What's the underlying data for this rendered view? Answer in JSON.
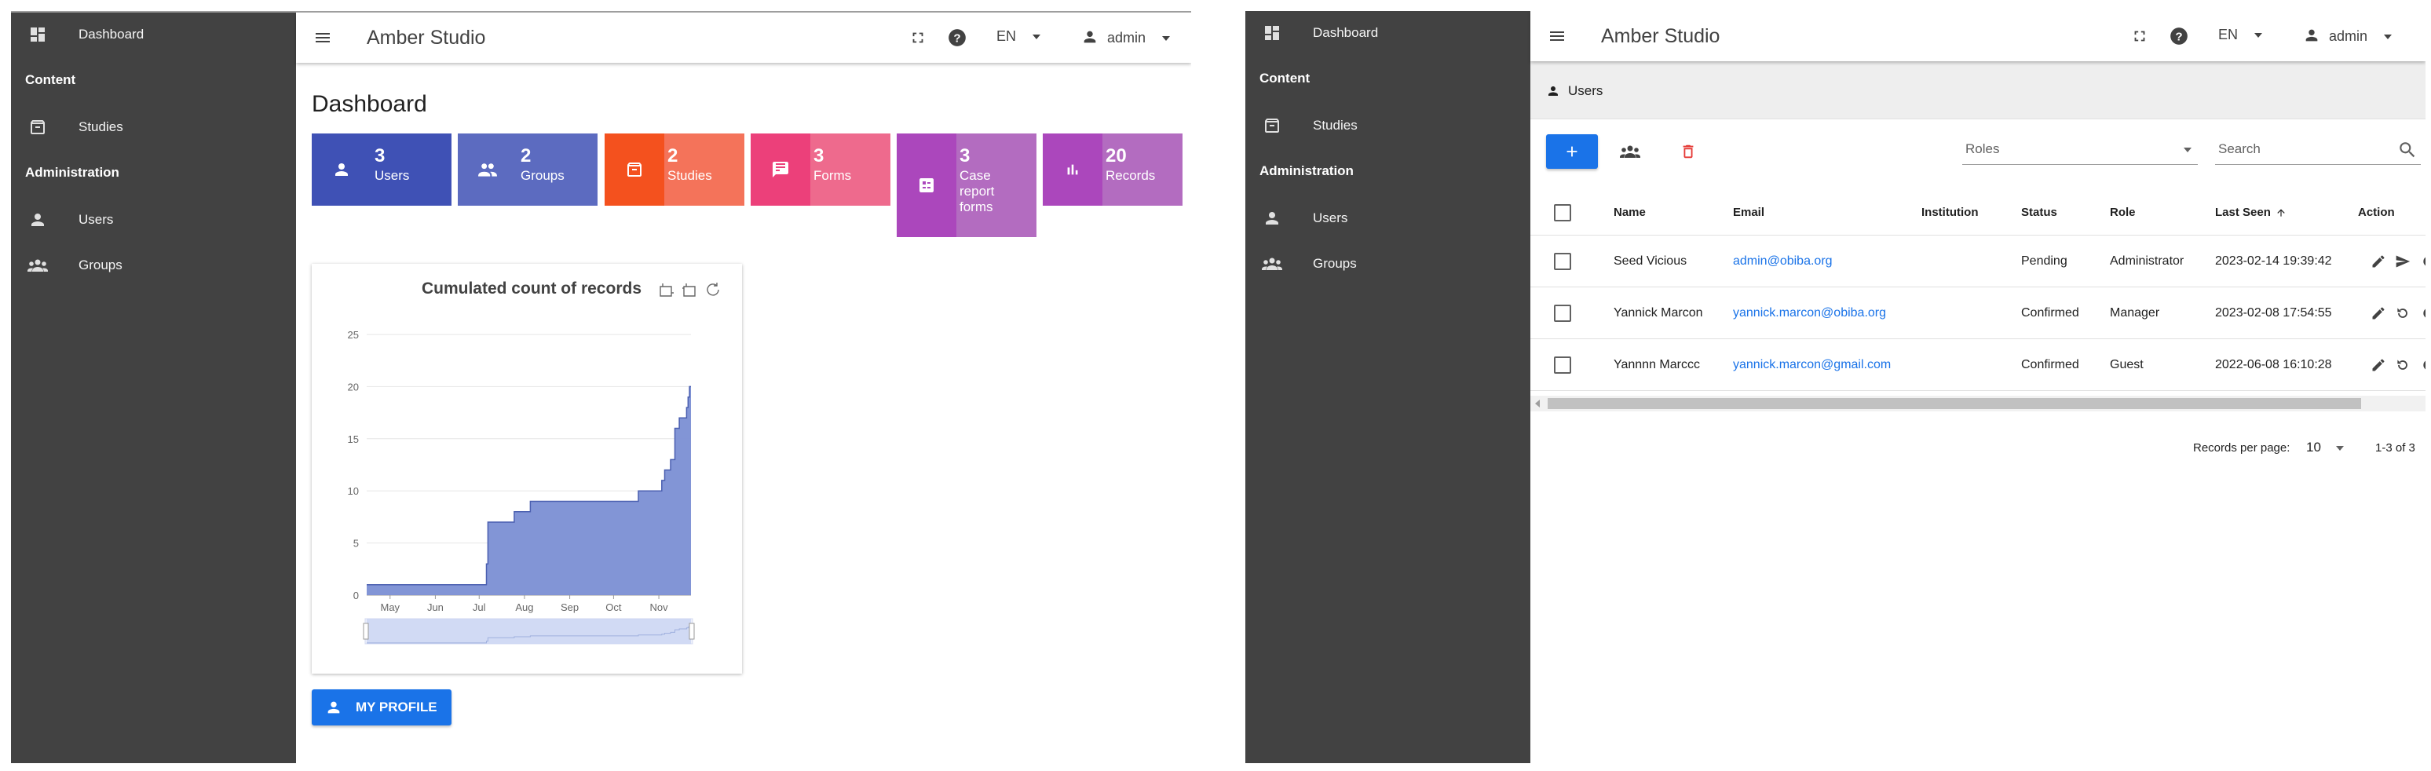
{
  "app": {
    "title": "Amber Studio",
    "lang": "EN",
    "user": "admin"
  },
  "sidebar": {
    "dashboard": "Dashboard",
    "content_section": "Content",
    "studies": "Studies",
    "admin_section": "Administration",
    "users": "Users",
    "groups": "Groups"
  },
  "dashboard": {
    "title": "Dashboard",
    "stats": [
      {
        "count": "3",
        "label": "Users",
        "icon": "person-icon",
        "color": "#3f51b5"
      },
      {
        "count": "2",
        "label": "Groups",
        "icon": "group-icon",
        "color": "#5c6bc0"
      },
      {
        "count": "2",
        "label": "Studies",
        "icon": "archive-icon",
        "color": "#f4511e"
      },
      {
        "count": "3",
        "label": "Forms",
        "icon": "forms-icon",
        "color": "#ec407a"
      },
      {
        "count": "3",
        "label_lines": [
          "Case",
          "report",
          "forms"
        ],
        "icon": "case-report-icon",
        "color": "#ab47bc"
      },
      {
        "count": "20",
        "label": "Records",
        "icon": "bar-chart-icon",
        "color": "#ab47bc"
      }
    ],
    "profile_button": "MY PROFILE"
  },
  "chart_data": {
    "type": "area",
    "title": "Cumulated count of records",
    "xlabel": "",
    "ylabel": "",
    "ylim": [
      0,
      25
    ],
    "yticks": [
      0,
      5,
      10,
      15,
      20,
      25
    ],
    "xticks": [
      "May",
      "Jun",
      "Jul",
      "Aug",
      "Sep",
      "Oct",
      "Nov"
    ],
    "xlim": [
      "2022-04-15",
      "2022-11-23"
    ],
    "grid": true,
    "legend": "none",
    "color": "#7b8fd4",
    "series": [
      {
        "x": [
          "2022-04-15",
          "2022-07-05",
          "2022-07-06",
          "2022-07-07",
          "2022-07-25",
          "2022-08-05",
          "2022-10-18",
          "2022-11-03",
          "2022-11-05",
          "2022-11-09",
          "2022-11-12",
          "2022-11-15",
          "2022-11-18",
          "2022-11-20",
          "2022-11-21",
          "2022-11-22",
          "2022-11-23"
        ],
        "y": [
          1,
          1,
          3,
          7,
          8,
          9,
          10,
          11,
          12,
          13,
          16,
          17,
          17,
          18,
          19,
          20,
          20
        ]
      }
    ]
  },
  "users_page": {
    "breadcrumb": "Users",
    "roles_placeholder": "Roles",
    "search_placeholder": "Search",
    "columns": [
      "Name",
      "Email",
      "Institution",
      "Status",
      "Role",
      "Last Seen",
      "Action"
    ],
    "rows": [
      {
        "name": "Seed Vicious",
        "email": "admin@obiba.org",
        "institution": "",
        "status": "Pending",
        "role": "Administrator",
        "last_seen": "2023-02-14 19:39:42"
      },
      {
        "name": "Yannick Marcon",
        "email": "yannick.marcon@obiba.org",
        "institution": "",
        "status": "Confirmed",
        "role": "Manager",
        "last_seen": "2023-02-08 17:54:55"
      },
      {
        "name": "Yannnn Marccc",
        "email": "yannick.marcon@gmail.com",
        "institution": "",
        "status": "Confirmed",
        "role": "Guest",
        "last_seen": "2022-06-08 16:10:28"
      }
    ],
    "records_per_page_label": "Records per page:",
    "records_per_page": "10",
    "range": "1-3 of 3"
  }
}
